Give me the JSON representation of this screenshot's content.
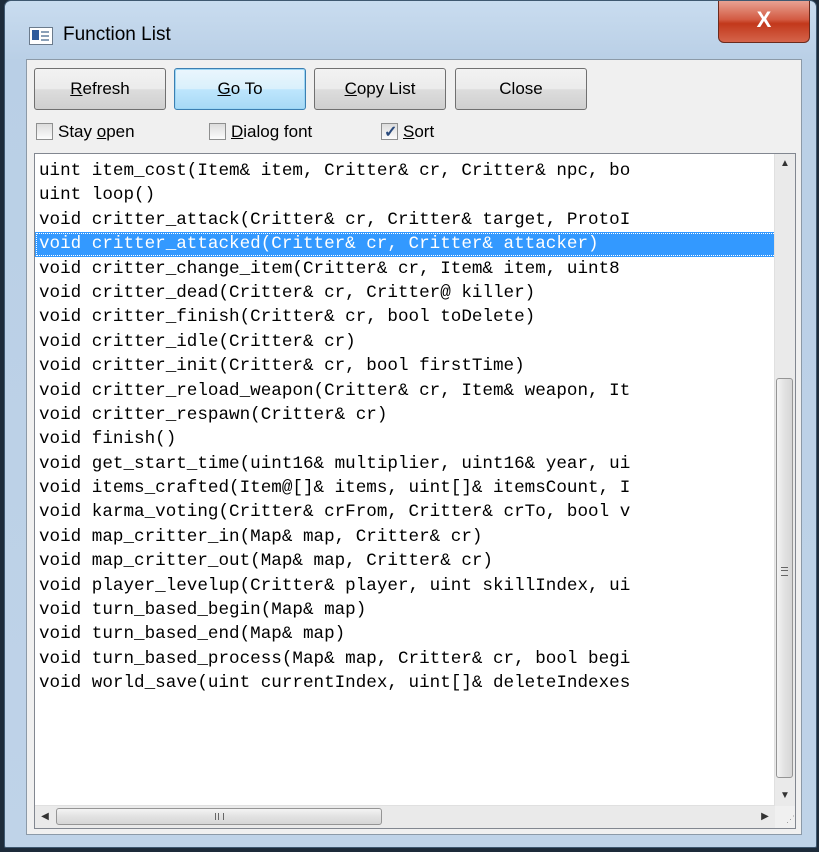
{
  "window": {
    "title": "Function List",
    "close_glyph": "X"
  },
  "toolbar": {
    "refresh": {
      "pre": "",
      "mn": "R",
      "post": "efresh"
    },
    "goto": {
      "pre": "",
      "mn": "G",
      "post": "o To"
    },
    "copy": {
      "pre": "",
      "mn": "C",
      "post": "opy List"
    },
    "close": "Close"
  },
  "options": {
    "stay_open": {
      "pre": "Stay ",
      "mn": "o",
      "post": "pen",
      "checked": false
    },
    "dialog_font": {
      "pre": "",
      "mn": "D",
      "post": "ialog font",
      "checked": false
    },
    "sort": {
      "pre": "",
      "mn": "S",
      "post": "ort",
      "checked": true
    }
  },
  "functions": [
    "uint item_cost(Item& item, Critter& cr, Critter& npc, bo",
    "uint loop()",
    "void critter_attack(Critter& cr, Critter& target, ProtoI",
    "void critter_attacked(Critter& cr, Critter& attacker)",
    "void critter_change_item(Critter& cr, Item& item, uint8 ",
    "void critter_dead(Critter& cr, Critter@ killer)",
    "void critter_finish(Critter& cr, bool toDelete)",
    "void critter_idle(Critter& cr)",
    "void critter_init(Critter& cr, bool firstTime)",
    "void critter_reload_weapon(Critter& cr, Item& weapon, It",
    "void critter_respawn(Critter& cr)",
    "void finish()",
    "void get_start_time(uint16& multiplier, uint16& year, ui",
    "void items_crafted(Item@[]& items, uint[]& itemsCount, I",
    "void karma_voting(Critter& crFrom, Critter& crTo, bool v",
    "void map_critter_in(Map& map, Critter& cr)",
    "void map_critter_out(Map& map, Critter& cr)",
    "void player_levelup(Critter& player, uint skillIndex, ui",
    "void turn_based_begin(Map& map)",
    "void turn_based_end(Map& map)",
    "void turn_based_process(Map& map, Critter& cr, bool begi",
    "void world_save(uint currentIndex, uint[]& deleteIndexes"
  ],
  "selected_index": 3,
  "icons": {
    "scroll_up": "triangle-up-icon",
    "scroll_down": "triangle-down-icon",
    "scroll_left": "triangle-left-icon",
    "scroll_right": "triangle-right-icon",
    "grip": "size-grip-icon"
  }
}
